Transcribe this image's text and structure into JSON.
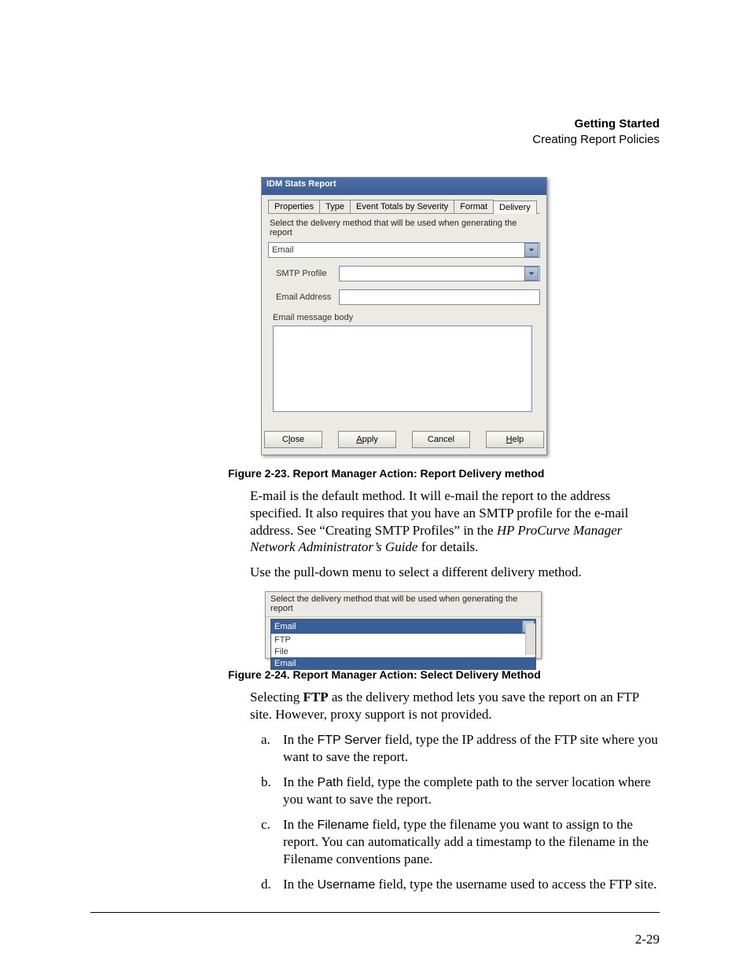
{
  "header": {
    "title": "Getting Started",
    "subtitle": "Creating Report Policies"
  },
  "figure1": {
    "titlebar": "IDM Stats Report",
    "tabs": [
      "Properties",
      "Type",
      "Event Totals by Severity",
      "Format",
      "Delivery"
    ],
    "activeTabIndex": 4,
    "instruction": "Select the delivery method that will be used when generating the report",
    "deliveryMethodValue": "Email",
    "fields": {
      "smtpProfileLabel": "SMTP Profile",
      "emailAddressLabel": "Email Address",
      "messageBodyLabel": "Email message body"
    },
    "buttons": {
      "close": {
        "pre": "C",
        "ul": "l",
        "post": "ose"
      },
      "apply": {
        "pre": "",
        "ul": "A",
        "post": "pply"
      },
      "cancel": "Cancel",
      "help": {
        "pre": "",
        "ul": "H",
        "post": "elp"
      }
    }
  },
  "caption1": "Figure 2-23. Report Manager Action: Report Delivery method",
  "para1a": "E-mail is the default method. It will e-mail the report to the address specified. It also requires that you have an SMTP profile for the e-mail address. See “Creating SMTP Profiles” in the ",
  "para1b": "HP ProCurve Manager Network Administrator’s Guide",
  "para1c": " for details.",
  "para2": "Use the pull-down menu to select a different delivery method.",
  "figure2": {
    "instruction": "Select the delivery method that will be used when generating the report",
    "selected": "Email",
    "options": [
      "FTP",
      "File",
      "Email"
    ],
    "highlightedIndex": 2
  },
  "caption2": "Figure 2-24. Report Manager Action: Select Delivery Method",
  "para3a": "Selecting ",
  "para3b": "FTP",
  "para3c": " as the delivery method lets you save the report on an FTP site. However, proxy support is not provided.",
  "steps": {
    "a": {
      "pre": "In the ",
      "field": "FTP Server",
      "post": " field, type the IP address of the FTP site where you want to save the report."
    },
    "b": {
      "pre": "In the ",
      "field": "Path",
      "post": " field, type the complete path to the server location where you want to save the report."
    },
    "c": {
      "pre": "In the ",
      "field": "Filename",
      "post": " field, type the filename you want to assign to the report. You can automatically add a timestamp to the filename in the Filename conventions pane."
    },
    "d": {
      "pre": "In the ",
      "field": "Username",
      "post": " field, type the username used to access the FTP site."
    }
  },
  "pageNumber": "2-29"
}
